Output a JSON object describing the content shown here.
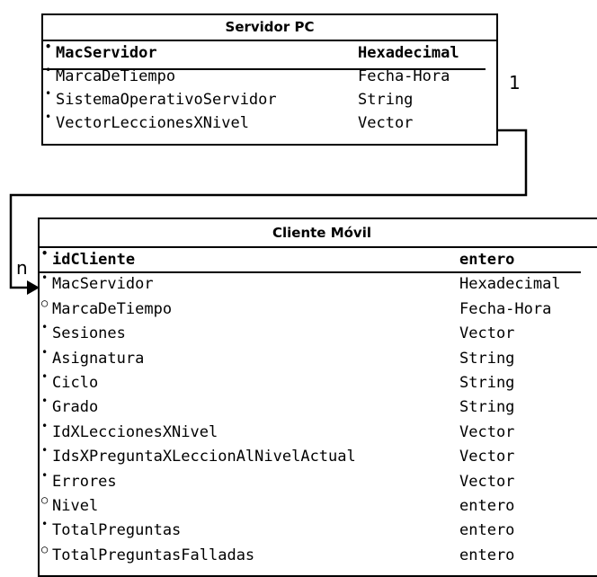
{
  "entities": {
    "servidor": {
      "title": "Servidor PC",
      "attributes": [
        {
          "bullet": "•",
          "name": "MacServidor",
          "type": "Hexadecimal",
          "key": true
        },
        {
          "bullet": "•",
          "name": "MarcaDeTiempo",
          "type": "Fecha-Hora",
          "key": false
        },
        {
          "bullet": "•",
          "name": "SistemaOperativoServidor",
          "type": "String",
          "key": false
        },
        {
          "bullet": "•",
          "name": "VectorLeccionesXNivel",
          "type": "Vector",
          "key": false
        }
      ]
    },
    "cliente": {
      "title": "Cliente Móvil",
      "attributes": [
        {
          "bullet": "•",
          "name": "idCliente",
          "type": "entero",
          "key": true
        },
        {
          "bullet": "•",
          "name": "MacServidor",
          "type": "Hexadecimal",
          "key": false
        },
        {
          "bullet": "○",
          "name": "MarcaDeTiempo",
          "type": "Fecha-Hora",
          "key": false
        },
        {
          "bullet": "•",
          "name": "Sesiones",
          "type": "Vector",
          "key": false
        },
        {
          "bullet": "•",
          "name": "Asignatura",
          "type": "String",
          "key": false
        },
        {
          "bullet": "•",
          "name": "Ciclo",
          "type": "String",
          "key": false
        },
        {
          "bullet": "•",
          "name": "Grado",
          "type": "String",
          "key": false
        },
        {
          "bullet": "•",
          "name": "IdXLeccionesXNivel",
          "type": "Vector",
          "key": false
        },
        {
          "bullet": "•",
          "name": "IdsXPreguntaXLeccionAlNivelActual",
          "type": "Vector",
          "key": false
        },
        {
          "bullet": "•",
          "name": "Errores",
          "type": "Vector",
          "key": false
        },
        {
          "bullet": "○",
          "name": "Nivel",
          "type": "entero",
          "key": false
        },
        {
          "bullet": "•",
          "name": "TotalPreguntas",
          "type": "entero",
          "key": false
        },
        {
          "bullet": "○",
          "name": "TotalPreguntasFalladas",
          "type": "entero",
          "key": false
        }
      ]
    }
  },
  "relationship": {
    "from_cardinality": "1",
    "to_cardinality": "n",
    "line_color": "#000000"
  }
}
